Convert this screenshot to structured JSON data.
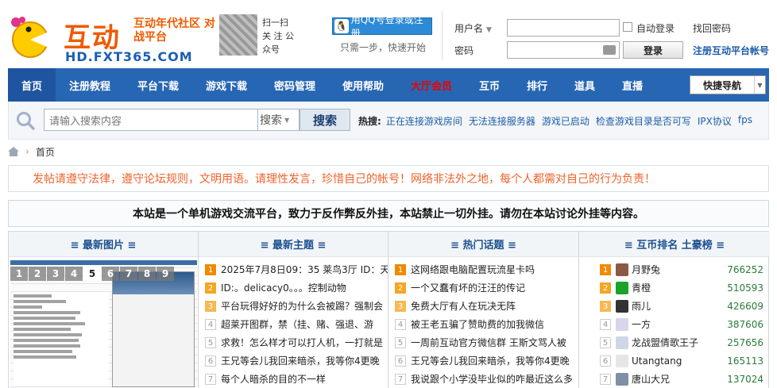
{
  "header": {
    "logo_title": "互动",
    "logo_subtitle": "互动年代社区 对战平台",
    "logo_url": "HD.FXT365.COM",
    "qr_caption": "扫一扫 关 注 公众号",
    "qq_login_label": "用QQ号登录或注册",
    "qq_tip": "只需一步，快速开始",
    "username_label": "用户名",
    "password_label": "密码",
    "auto_login_label": "自动登录",
    "find_password_label": "找回密码",
    "login_button": "登录",
    "register_link": "注册互动平台帐号"
  },
  "nav": {
    "items": [
      {
        "label": "首页",
        "active": true
      },
      {
        "label": "注册教程"
      },
      {
        "label": "平台下载"
      },
      {
        "label": "游戏下载"
      },
      {
        "label": "密码管理"
      },
      {
        "label": "使用帮助"
      },
      {
        "label": "大厅会员",
        "vip": true
      },
      {
        "label": "互币"
      },
      {
        "label": "排行"
      },
      {
        "label": "道具"
      },
      {
        "label": "直播"
      }
    ],
    "quick_nav_label": "快捷导航"
  },
  "search": {
    "placeholder": "请输入搜索内容",
    "select_label": "搜索",
    "button_label": "搜索",
    "hot_label": "热搜:",
    "hot_terms": [
      "正在连接游戏房间",
      "无法连接服务器",
      "游戏已启动",
      "检查游戏目录是否可写",
      "IPX协议",
      "fps"
    ]
  },
  "breadcrumb": {
    "home": "首页"
  },
  "notice": "发帖请遵守法律，遵守论坛规则，文明用语。请理性发言，珍惜自己的帐号！网络非法外之地，每个人都需对自己的行为负责！",
  "announcement": "本站是一个单机游戏交流平台，致力于反作弊反外挂，本站禁止一切外挂。请勿在本站讨论外挂等内容。",
  "columns": {
    "latest_images": {
      "title": "≡ 最新图片 ≡",
      "pager": [
        "1",
        "2",
        "3",
        "4",
        "5",
        "6",
        "7",
        "8",
        "9"
      ],
      "active_page": "5"
    },
    "latest_topics": {
      "title": "≡ 最新主题 ≡",
      "items": [
        "2025年7月8日09：35 莱鸟3厅 ID：天",
        "ID:。delicacy0。。。控制动物",
        "平台玩得好好的为什么会被踢？强制会",
        "超莱开图群，禁（挂、赌、强退、游",
        "求救！怎么样才可以打人机，一打就是",
        "王兄等会儿我回来暗杀，我等你4更晚",
        "每个人暗杀的目的不一样"
      ]
    },
    "hot_topics": {
      "title": "≡ 热门话题 ≡",
      "items": [
        "这网络跟电脑配置玩流星卡吗",
        "一个又蠢有坏的汪汪的传记",
        "免费大厅有人在玩决无阵",
        "被王老五骗了赞助费的加我微信",
        "一周前互动官方微信群 王斯文骂人被",
        "王兄等会儿我回来暗杀，我等你4更晚",
        "我说跟个小学没毕业似的咋最近这么多"
      ]
    },
    "ranking": {
      "title": "≡ 互币排名 土豪榜 ≡",
      "items": [
        {
          "name": "月野兔",
          "score": "766252",
          "avatar_color": "#8a5a44"
        },
        {
          "name": "青橙",
          "score": "510593",
          "avatar_color": "#1aa32a"
        },
        {
          "name": "雨儿",
          "score": "426609",
          "avatar_color": "#333333"
        },
        {
          "name": "一方",
          "score": "387606",
          "avatar_color": "#d9d4ea"
        },
        {
          "name": "龙战盟倩歌王子",
          "score": "257656",
          "avatar_color": "#cfd7e6"
        },
        {
          "name": "Utangtang",
          "score": "165113",
          "avatar_color": "#e6e6e6"
        },
        {
          "name": "唐山大兄",
          "score": "137024",
          "avatar_color": "#7e8fa6"
        }
      ]
    }
  }
}
